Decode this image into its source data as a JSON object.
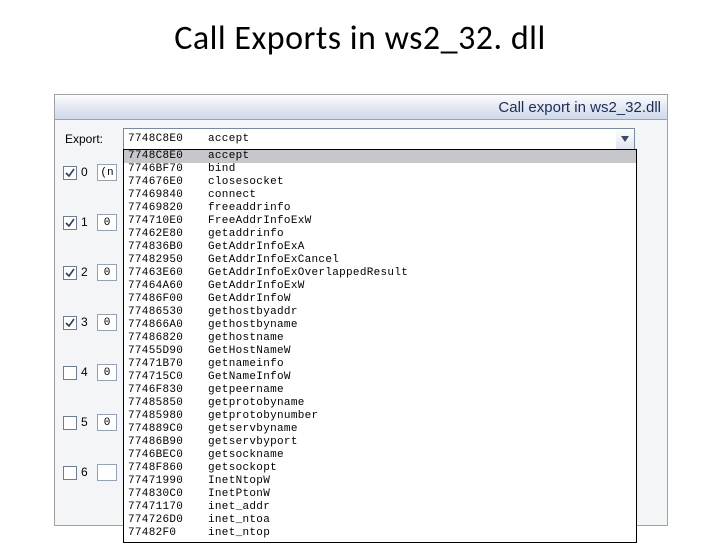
{
  "slide": {
    "title": "Call Exports in ws2_32. dll"
  },
  "window": {
    "title": "Call export in ws2_32.dll"
  },
  "export": {
    "label": "Export:",
    "selected_addr": "7748C8E0",
    "selected_name": "accept"
  },
  "side_rows": [
    {
      "checked": true,
      "index": "0",
      "box": "(n"
    },
    {
      "checked": true,
      "index": "1",
      "box": "0"
    },
    {
      "checked": true,
      "index": "2",
      "box": "0"
    },
    {
      "checked": true,
      "index": "3",
      "box": "0"
    },
    {
      "checked": false,
      "index": "4",
      "box": "0"
    },
    {
      "checked": false,
      "index": "5",
      "box": "0"
    },
    {
      "checked": false,
      "index": "6",
      "box": ""
    }
  ],
  "exports": [
    {
      "addr": "7748C8E0",
      "name": "accept"
    },
    {
      "addr": "7746BF70",
      "name": "bind"
    },
    {
      "addr": "774676E0",
      "name": "closesocket"
    },
    {
      "addr": "77469840",
      "name": "connect"
    },
    {
      "addr": "77469820",
      "name": "freeaddrinfo"
    },
    {
      "addr": "774710E0",
      "name": "FreeAddrInfoExW"
    },
    {
      "addr": "77462E80",
      "name": "getaddrinfo"
    },
    {
      "addr": "774836B0",
      "name": "GetAddrInfoExA"
    },
    {
      "addr": "77482950",
      "name": "GetAddrInfoExCancel"
    },
    {
      "addr": "77463E60",
      "name": "GetAddrInfoExOverlappedResult"
    },
    {
      "addr": "77464A60",
      "name": "GetAddrInfoExW"
    },
    {
      "addr": "77486F00",
      "name": "GetAddrInfoW"
    },
    {
      "addr": "77486530",
      "name": "gethostbyaddr"
    },
    {
      "addr": "774866A0",
      "name": "gethostbyname"
    },
    {
      "addr": "77486820",
      "name": "gethostname"
    },
    {
      "addr": "77455D90",
      "name": "GetHostNameW"
    },
    {
      "addr": "77471B70",
      "name": "getnameinfo"
    },
    {
      "addr": "774715C0",
      "name": "GetNameInfoW"
    },
    {
      "addr": "7746F830",
      "name": "getpeername"
    },
    {
      "addr": "77485850",
      "name": "getprotobyname"
    },
    {
      "addr": "77485980",
      "name": "getprotobynumber"
    },
    {
      "addr": "774889C0",
      "name": "getservbyname"
    },
    {
      "addr": "77486B90",
      "name": "getservbyport"
    },
    {
      "addr": "7746BEC0",
      "name": "getsockname"
    },
    {
      "addr": "7748F860",
      "name": "getsockopt"
    },
    {
      "addr": "77471990",
      "name": "InetNtopW"
    },
    {
      "addr": "774830C0",
      "name": "InetPtonW"
    },
    {
      "addr": "77471170",
      "name": "inet_addr"
    },
    {
      "addr": "774726D0",
      "name": "inet_ntoa"
    },
    {
      "addr": "77482F0",
      "name": "inet_ntop"
    }
  ]
}
